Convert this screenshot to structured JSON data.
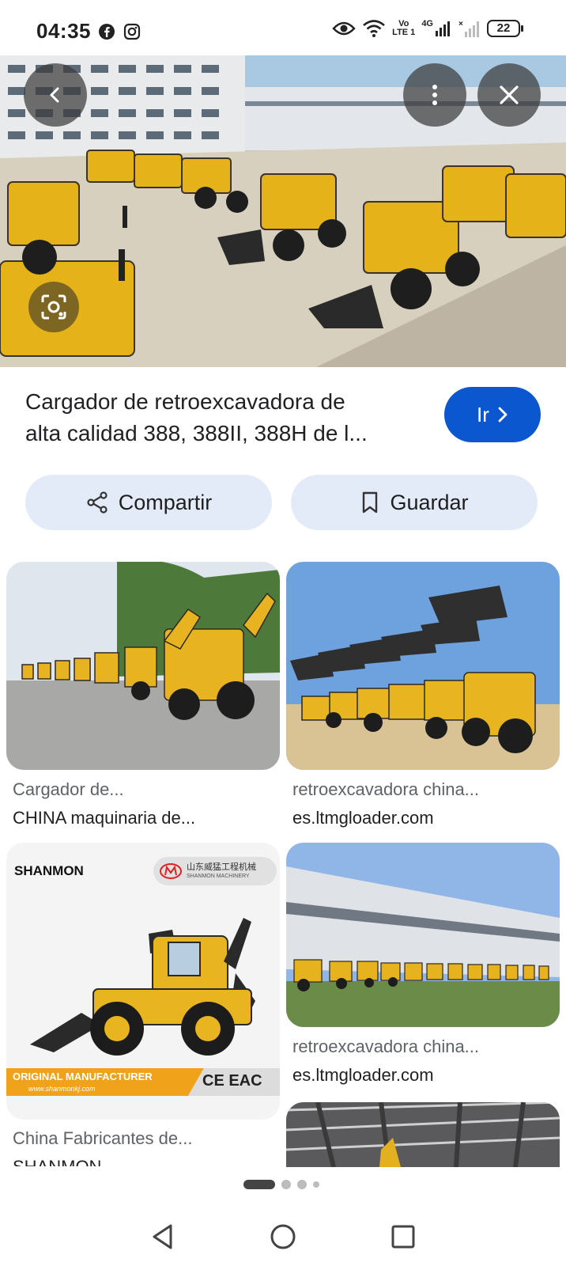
{
  "status_bar": {
    "time": "04:35",
    "left_icons": [
      "facebook-icon",
      "instagram-icon"
    ],
    "vo_label": "Vo",
    "lte_label": "LTE 1",
    "net_label": "4G",
    "battery": "22"
  },
  "hero": {
    "back_icon": "chevron-left-icon",
    "menu_icon": "more-vert-icon",
    "close_icon": "close-icon",
    "lens_icon": "google-lens-icon"
  },
  "result": {
    "title_line1": "Cargador de retroexcavadora de",
    "title_line2": "alta calidad 388, 388II, 388H de l...",
    "go_label": "Ir",
    "share_label": "Compartir",
    "save_label": "Guardar",
    "accent": "#0b57d0"
  },
  "related": [
    {
      "title": "Cargador de...",
      "source": "CHINA maquinaria de..."
    },
    {
      "title": "retroexcavadora china...",
      "source": "es.ltmgloader.com"
    },
    {
      "title": "China Fabricantes de...",
      "source": "SHANMON",
      "brand": "SHANMON",
      "brand_cn": "山东威猛工程机械",
      "brand_en": "SHANMON MACHINERY",
      "banner": "ORIGINAL MANUFACTURER",
      "url": "www.shanmonkj.com",
      "marks": "CE EAC"
    },
    {
      "title": "retroexcavadora china...",
      "source": "es.ltmgloader.com"
    }
  ],
  "navigation": {
    "back_icon": "triangle-back-icon",
    "home_icon": "circle-home-icon",
    "recents_icon": "square-recents-icon"
  }
}
